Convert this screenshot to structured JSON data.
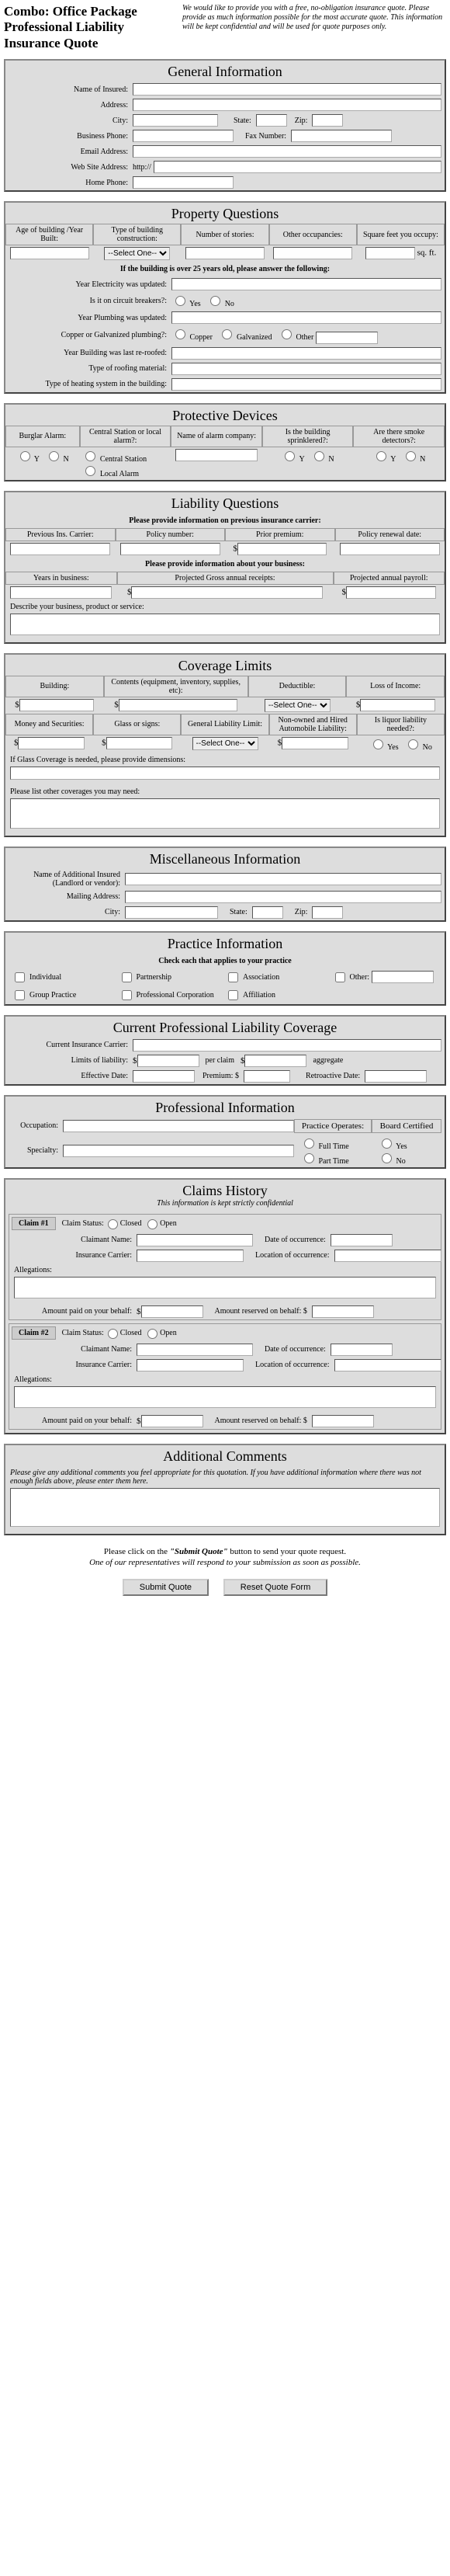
{
  "header": {
    "title": "Combo: Office Package Professional Liability Insurance Quote",
    "desc": "We would like to provide you with a free, no-obligation insurance quote. Please provide as much information possible for the most accurate quote. This information will be kept confidential and will be used for quote purposes only."
  },
  "general": {
    "title": "General Information",
    "name_lbl": "Name of Insured:",
    "address_lbl": "Address:",
    "city_lbl": "City:",
    "state_lbl": "State:",
    "zip_lbl": "Zip:",
    "bphone_lbl": "Business Phone:",
    "fax_lbl": "Fax Number:",
    "email_lbl": "Email Address:",
    "web_lbl": "Web Site Address:",
    "web_prefix": "http://",
    "hphone_lbl": "Home Phone:"
  },
  "property": {
    "title": "Property Questions",
    "h1": "Age of building /Year Built:",
    "h2": "Type of building construction:",
    "h3": "Number of stories:",
    "h4": "Other occupancies:",
    "h5": "Square feet you occupy:",
    "sqft": "sq. ft.",
    "select_one": "--Select One--",
    "note": "If the building is over 25 years old, please answer the following:",
    "q1": "Year Electricity was updated:",
    "q2": "Is it on circuit breakers?:",
    "q3": "Year Plumbing was updated:",
    "q4": "Copper or Galvanized plumbing?:",
    "q5": "Year Building was last re-roofed:",
    "q6": "Type of roofing material:",
    "q7": "Type of heating system in the building:",
    "yes": "Yes",
    "no": "No",
    "copper": "Copper",
    "galv": "Galvanized",
    "other": "Other"
  },
  "protective": {
    "title": "Protective Devices",
    "h1": "Burglar Alarm:",
    "h2": "Central Station or local alarm?:",
    "h3": "Name of alarm company:",
    "h4": "Is the building sprinklered?:",
    "h5": "Are there smoke detectors?:",
    "y": "Y",
    "n": "N",
    "cs": "Central Station",
    "la": "Local Alarm"
  },
  "liability": {
    "title": "Liability Questions",
    "note1": "Please provide information on previous insurance carrier:",
    "h1": "Previous Ins. Carrier:",
    "h2": "Policy number:",
    "h3": "Prior premium:",
    "h4": "Policy renewal date:",
    "note2": "Please provide information about your business:",
    "h5": "Years in business:",
    "h6": "Projected Gross annual receipts:",
    "h7": "Projected annual payroll:",
    "desc_lbl": "Describe your business, product or service:"
  },
  "coverage": {
    "title": "Coverage Limits",
    "h1": "Building:",
    "h2": "Contents (equipment, inventory, supplies, etc):",
    "h3": "Deductible:",
    "h4": "Loss of Income:",
    "h5": "Money and Securities:",
    "h6": "Glass or signs:",
    "h7": "General Liability Limit:",
    "h8": "Non-owned and Hired Automobile Liability:",
    "h9": "Is liquor liability needed?:",
    "select_one": "--Select One--",
    "yes": "Yes",
    "no": "No",
    "glass_note": "If Glass Coverage is needed, please provide dimensions:",
    "other_note": "Please list other coverages you may need:"
  },
  "misc": {
    "title": "Miscellaneous Information",
    "l1": "Name of Additional Insured (Landlord or vendor):",
    "l2": "Mailing Address:",
    "l3": "City:",
    "state": "State:",
    "zip": "Zip:"
  },
  "practice": {
    "title": "Practice Information",
    "sub": "Check each that applies to your practice",
    "c1": "Individual",
    "c2": "Partnership",
    "c3": "Association",
    "c4": "Other:",
    "c5": "Group Practice",
    "c6": "Professional Corporation",
    "c7": "Affiliation"
  },
  "current_liab": {
    "title": "Current Professional Liability Coverage",
    "l1": "Current Insurance Carrier:",
    "l2": "Limits of liability:",
    "per": "per claim",
    "agg": "aggregate",
    "l3": "Effective Date:",
    "prem": "Premium: $",
    "retro": "Retroactive Date:"
  },
  "prof": {
    "title": "Professional Information",
    "occ": "Occupation:",
    "prac_op": "Practice Operates:",
    "board": "Board Certified",
    "spec": "Specialty:",
    "ft": "Full Time",
    "pt": "Part Time",
    "yes": "Yes",
    "no": "No"
  },
  "claims": {
    "title": "Claims History",
    "sub": "This information is kept strictly confidential",
    "c1": "Claim #1",
    "c2": "Claim #2",
    "status": "Claim Status:",
    "closed": "Closed",
    "open": "Open",
    "name": "Claimant Name:",
    "doc": "Date of occurrence:",
    "carrier": "Insurance Carrier:",
    "loc": "Location of occurrence:",
    "alleg": "Allegations:",
    "paid": "Amount paid on your behalf:",
    "reserved": "Amount reserved on behalf: $"
  },
  "additional": {
    "title": "Additional Comments",
    "note": "Please give any additional comments you feel appropriate for this quotation. If you have additional information where there was not enough fields above, please enter them here."
  },
  "submit": {
    "t1_a": "Please click on the ",
    "t1_b": "\"Submit Quote\"",
    "t1_c": " button to send your quote request.",
    "t2": "One of our representatives will respond to your submission as soon as possible.",
    "btn1": "Submit Quote",
    "btn2": "Reset Quote Form"
  }
}
